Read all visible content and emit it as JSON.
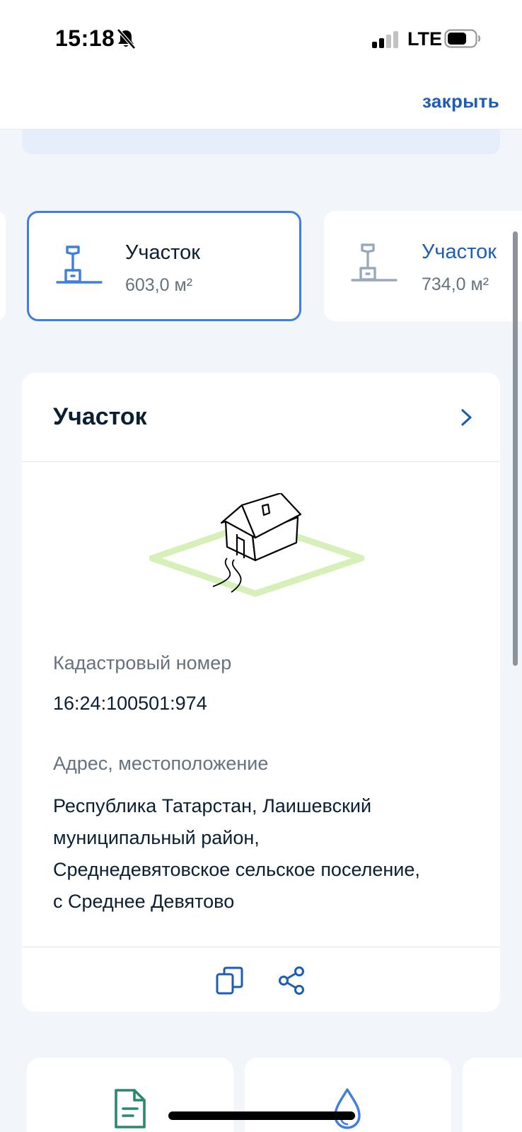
{
  "status_bar": {
    "time": "15:18",
    "network": "LTE"
  },
  "header": {
    "close_label": "закрыть"
  },
  "parcels": [
    {
      "title": "Участок",
      "area": "603,0 м²",
      "selected": true
    },
    {
      "title": "Участок",
      "area": "734,0 м²",
      "selected": false
    }
  ],
  "details": {
    "title": "Участок",
    "cadastral_label": "Кадастровый номер",
    "cadastral_value": "16:24:100501:974",
    "address_label": "Адрес, местоположение",
    "address_lines": [
      "Республика Татарстан, Лаишевский",
      "муниципальный район,",
      "Среднедевятовское сельское поселение,",
      "с Среднее Девятово"
    ]
  },
  "colors": {
    "accent": "#1c5db5",
    "selected_border": "#3f7ee0",
    "muted_text": "#66727f",
    "background": "#f2f5fa",
    "plot_outline": "#c8e8a0",
    "doc_icon": "#2a8a68"
  },
  "icons": {
    "status": [
      "bell-off-icon",
      "signal-icon",
      "battery-icon"
    ],
    "parcel": "parcel-plot-icon",
    "header": "chevron-right-icon",
    "actions": [
      "copy-icon",
      "share-icon"
    ],
    "tiles": [
      "document-icon",
      "water-drop-icon"
    ]
  }
}
